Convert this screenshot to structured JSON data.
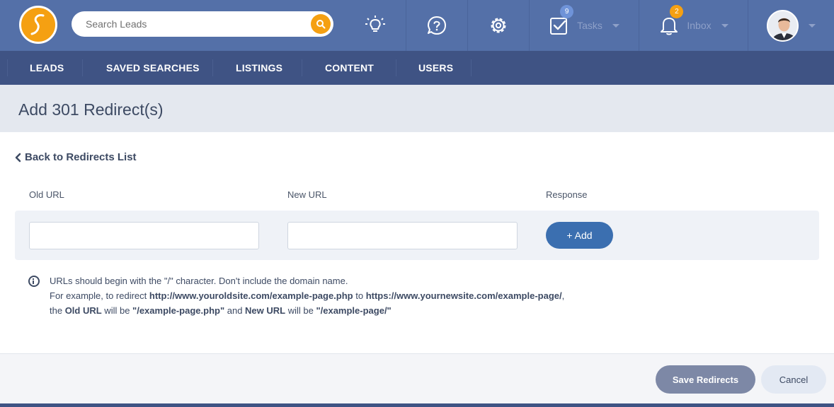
{
  "topbar": {
    "search": {
      "placeholder": "Search Leads"
    },
    "tasks": {
      "label": "Tasks",
      "badge": "9",
      "badge_color": "#6f93d8"
    },
    "inbox": {
      "label": "Inbox",
      "badge": "2",
      "badge_color": "#f5a012"
    },
    "brand_color": "#f5a012"
  },
  "nav": {
    "items": [
      {
        "label": "LEADS"
      },
      {
        "label": "SAVED SEARCHES"
      },
      {
        "label": "LISTINGS"
      },
      {
        "label": "CONTENT"
      },
      {
        "label": "USERS"
      }
    ]
  },
  "page": {
    "title": "Add 301 Redirect(s)",
    "back_link": "Back to Redirects List"
  },
  "form": {
    "columns": {
      "old_url": "Old URL",
      "new_url": "New URL",
      "response": "Response"
    },
    "old_url_value": "",
    "new_url_value": "",
    "add_button": "+ Add"
  },
  "info": {
    "line1": "URLs should begin with the \"/\" character. Don't include the domain name.",
    "line2_prefix": "For example, to redirect ",
    "old_site": "http://www.youroldsite.com/example-page.php",
    "line2_mid": " to ",
    "new_site": "https://www.yournewsite.com/example-page/",
    "line2_suffix": ",",
    "line3_a": "the ",
    "old_label": "Old URL",
    "line3_b": " will be ",
    "old_value": "\"/example-page.php\"",
    "line3_c": " and ",
    "new_label": "New URL",
    "line3_d": " will be ",
    "new_value": "\"/example-page/\""
  },
  "footer": {
    "save_label": "Save Redirects",
    "cancel_label": "Cancel"
  }
}
